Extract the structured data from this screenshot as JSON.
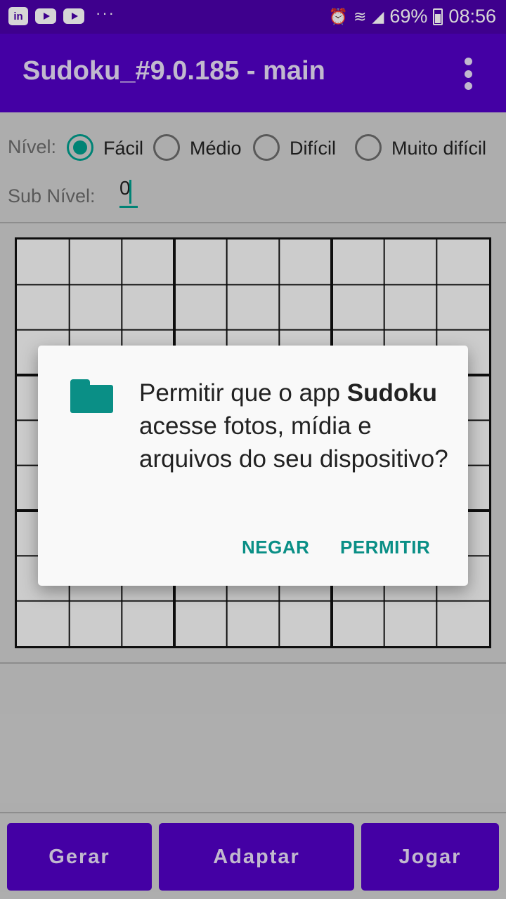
{
  "status_bar": {
    "icons": [
      "linkedin-icon",
      "youtube-icon",
      "youtube-icon",
      "more-dots-icon"
    ],
    "right_icons": [
      "alarm-icon",
      "wifi-icon",
      "signal-icon",
      "battery-icon"
    ],
    "battery": "69%",
    "time": "08:56",
    "linkedin_label": "in",
    "dots": "···"
  },
  "app_bar": {
    "title": "Sudoku_#9.0.185 - main",
    "menu_icon": "overflow-menu-icon"
  },
  "level": {
    "label": "Nível:",
    "options": [
      "Fácil",
      "Médio",
      "Difícil",
      "Muito difícil"
    ],
    "selected": "Fácil"
  },
  "sub_level": {
    "label": "Sub Nível:",
    "value": "0"
  },
  "dialog": {
    "icon": "folder-icon",
    "message_prefix": "Permitir que o app ",
    "message_app": "Sudoku",
    "message_suffix": " acesse fotos, mídia e arquivos do seu dispositivo?",
    "deny_label": "NEGAR",
    "allow_label": "PERMITIR"
  },
  "buttons": {
    "generate": "Gerar",
    "adapt": "Adaptar",
    "play": "Jogar"
  },
  "colors": {
    "primary": "#5201c4",
    "status_bar": "#4a00a8",
    "accent": "#009c8c",
    "dialog_button": "#0a8f86"
  }
}
